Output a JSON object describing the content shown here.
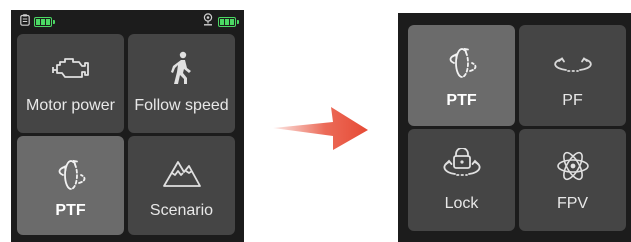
{
  "colors": {
    "screen_bg": "#1c1c1c",
    "tile_bg": "#454545",
    "tile_active_bg": "#6b6b6b",
    "battery": "#4cd964",
    "arrow": "#e8503a"
  },
  "left_screen": {
    "status_left_icons": [
      "clipboard-icon",
      "battery-icon"
    ],
    "status_right_icons": [
      "camera-person-icon",
      "battery-icon"
    ],
    "tiles": [
      {
        "label": "Motor power",
        "icon": "engine-icon",
        "active": false
      },
      {
        "label": "Follow speed",
        "icon": "walking-person-icon",
        "active": false
      },
      {
        "label": "PTF",
        "icon": "ptf-rotate-icon",
        "active": true
      },
      {
        "label": "Scenario",
        "icon": "mountain-icon",
        "active": false
      }
    ]
  },
  "transition_icon": "right-arrow-icon",
  "right_screen": {
    "tiles": [
      {
        "label": "PTF",
        "icon": "ptf-rotate-icon",
        "active": true
      },
      {
        "label": "PF",
        "icon": "pf-rotate-icon",
        "active": false
      },
      {
        "label": "Lock",
        "icon": "lock-rotate-icon",
        "active": false
      },
      {
        "label": "FPV",
        "icon": "atom-icon",
        "active": false
      }
    ]
  }
}
